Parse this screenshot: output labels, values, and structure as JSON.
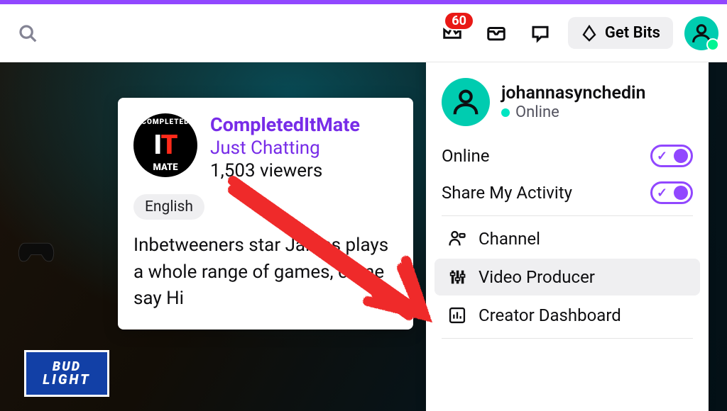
{
  "colors": {
    "accent": "#9147ff",
    "success": "#00e5c2",
    "badge": "#e91916"
  },
  "topbar": {
    "notifications_count": "60",
    "bits_label": "Get Bits"
  },
  "tooltip": {
    "streamer_name": "CompletedItMate",
    "category": "Just Chatting",
    "viewers": "1,503 viewers",
    "tag": "English",
    "description": "Inbetweeners star James plays a whole range of games, come say Hi",
    "avatar_top": "COMPLETED",
    "avatar_mid_1": "I",
    "avatar_mid_2": "T",
    "avatar_bot": "MATE"
  },
  "stream_overlay": {
    "ad_line1": "BUD",
    "ad_line2": "LIGHT"
  },
  "dropdown": {
    "username": "johannasynchedin",
    "status": "Online",
    "toggles": {
      "online": "Online",
      "share_activity": "Share My Activity"
    },
    "menu": {
      "channel": "Channel",
      "video_producer": "Video Producer",
      "creator_dashboard": "Creator Dashboard"
    }
  }
}
